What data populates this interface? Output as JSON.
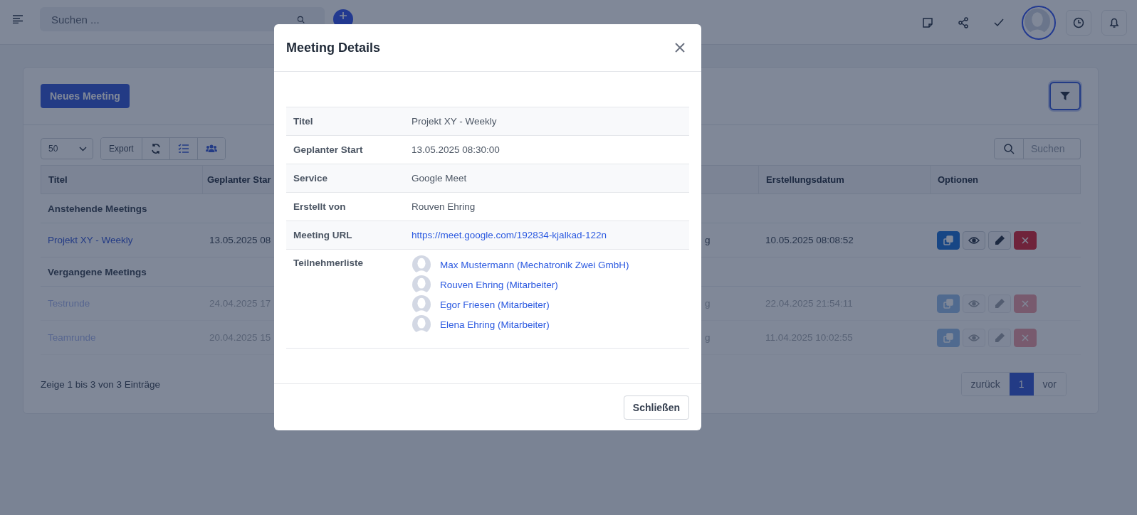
{
  "topbar": {
    "search": {
      "placeholder": "Suchen ..."
    }
  },
  "toolbar": {
    "new_button": "Neues Meeting",
    "page_size": "50",
    "export_button": "Export"
  },
  "table": {
    "search": {
      "placeholder": "Suchen"
    },
    "columns": [
      "Titel",
      "Geplanter Star",
      "Erstellungsdatum",
      "Optionen"
    ],
    "groups": [
      {
        "label": "Anstehende Meetings",
        "rows": [
          {
            "title": "Projekt XY - Weekly",
            "column_2": "13.05.2025 08",
            "column_3": "g",
            "created": "10.05.2025 08:08:52",
            "dimmed": false
          }
        ]
      },
      {
        "label": "Vergangene Meetings",
        "rows": [
          {
            "title": "Testrunde",
            "column_2": "24.04.2025 17",
            "column_3": "g",
            "created": "22.04.2025 21:54:11",
            "dimmed": true
          },
          {
            "title": "Teamrunde",
            "column_2": "20.04.2025 15",
            "column_3": "g",
            "created": "11.04.2025 10:02:55",
            "dimmed": true
          }
        ]
      }
    ]
  },
  "footer": {
    "info": "Zeige 1 bis 3 von 3 Einträge",
    "pagination": [
      {
        "label": "zurück",
        "selected": false
      },
      {
        "label": "1",
        "selected": true
      },
      {
        "label": "vor",
        "selected": false
      }
    ]
  },
  "modal": {
    "title": "Meeting Details",
    "details": [
      {
        "kind": "text",
        "label": "Titel",
        "value": "Projekt XY - Weekly"
      },
      {
        "kind": "text",
        "label": "Geplanter Start",
        "value": "13.05.2025 08:30:00"
      },
      {
        "kind": "text",
        "label": "Service",
        "value": "Google Meet"
      },
      {
        "kind": "text",
        "label": "Erstellt von",
        "value": "Rouven Ehring"
      },
      {
        "kind": "link",
        "label": "Meeting URL",
        "value": "https://meet.google.com/192834-kjalkad-122n"
      },
      {
        "kind": "participants",
        "label": "Teilnehmerliste",
        "participants": [
          "Max Mustermann (Mechatronik Zwei GmbH)",
          "Rouven Ehring (Mitarbeiter)",
          "Egor Friesen (Mitarbeiter)",
          "Elena Ehring (Mitarbeiter)"
        ]
      }
    ],
    "close_button": "Schließen"
  }
}
